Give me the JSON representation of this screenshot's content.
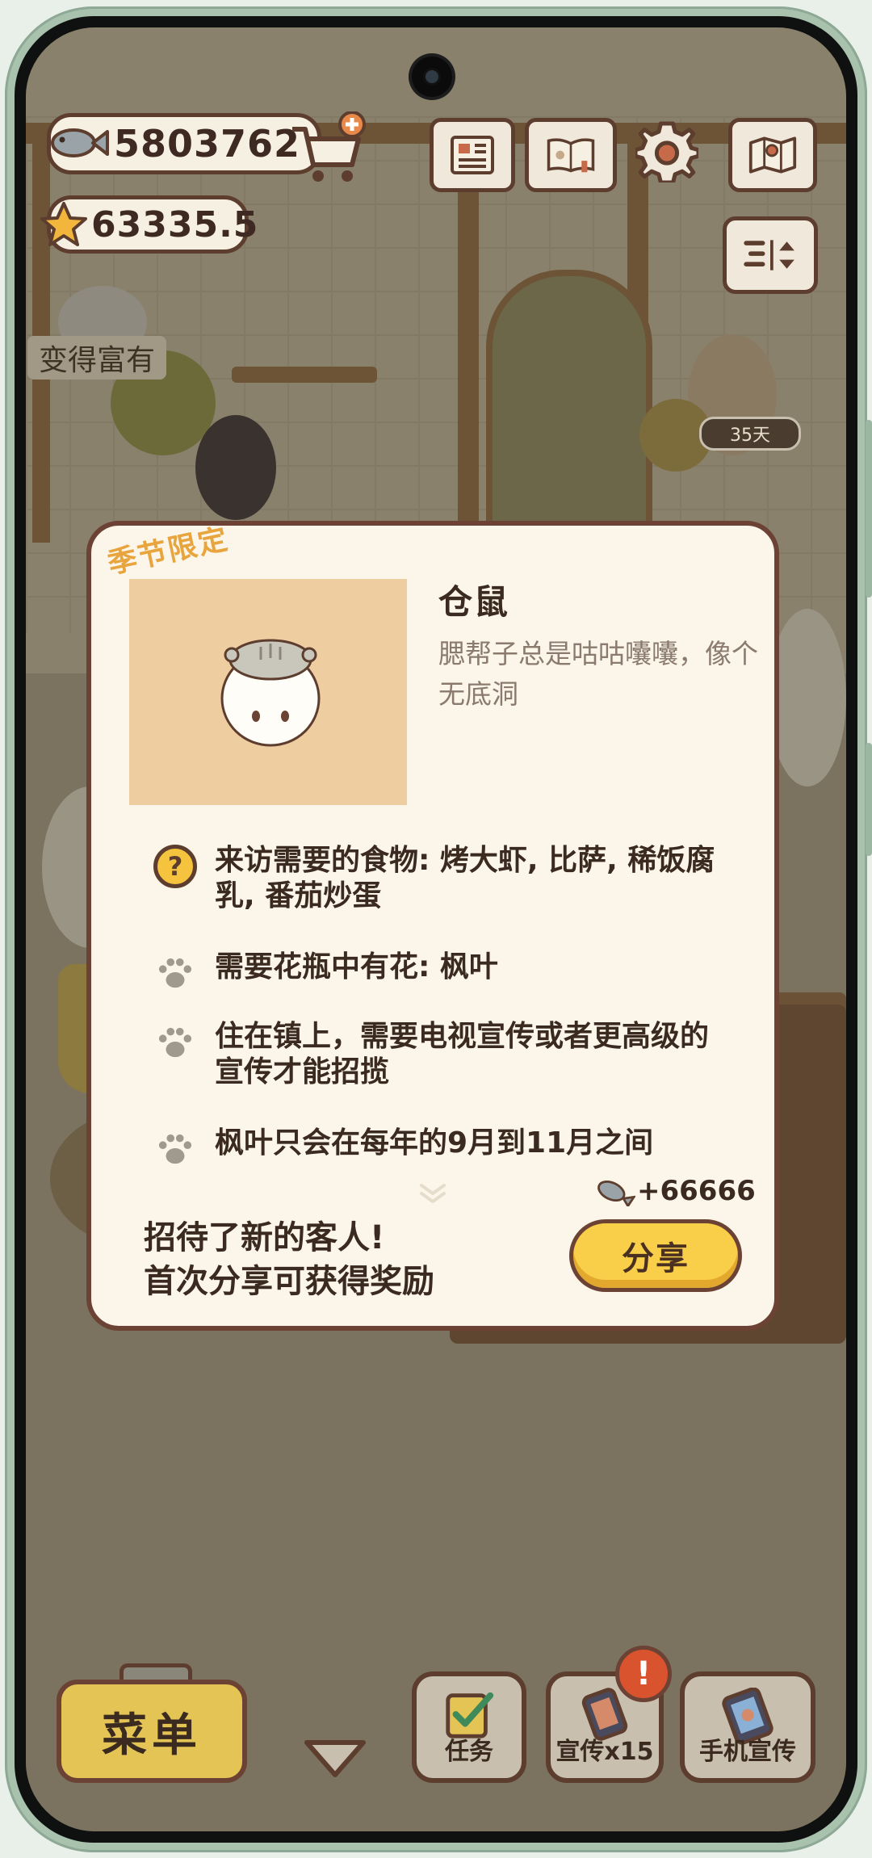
{
  "hud": {
    "fish_currency": "5803762",
    "star_currency": "63335.5",
    "rich_tag": "变得富有",
    "days_tag": "35天"
  },
  "modal": {
    "season_tag": "季节限定",
    "name": "仓鼠",
    "description": "腮帮子总是咕咕囔囔，像个无底洞",
    "requirements": [
      {
        "icon": "question-icon",
        "text": "来访需要的食物: 烤大虾, 比萨, 稀饭腐乳, 番茄炒蛋"
      },
      {
        "icon": "paw-icon",
        "text": "需要花瓶中有花: 枫叶"
      },
      {
        "icon": "paw-icon",
        "text": "住在镇上，需要电视宣传或者更高级的宣传才能招揽"
      },
      {
        "icon": "paw-icon",
        "text": "枫叶只会在每年的9月到11月之间"
      }
    ],
    "reward": "+66666",
    "share_note_line1": "招待了新的客人!",
    "share_note_line2": "首次分享可获得奖励",
    "share_button": "分享"
  },
  "bottom_bar": {
    "menu": "菜单",
    "tasks": "任务",
    "promo": "宣传x15",
    "phone_promo": "手机宣传",
    "alert": "!"
  },
  "colors": {
    "accent_yellow": "#f9cf4a",
    "border_brown": "#6b4233",
    "modal_bg": "#fbf5ea",
    "season_orange": "#e8a43d"
  }
}
